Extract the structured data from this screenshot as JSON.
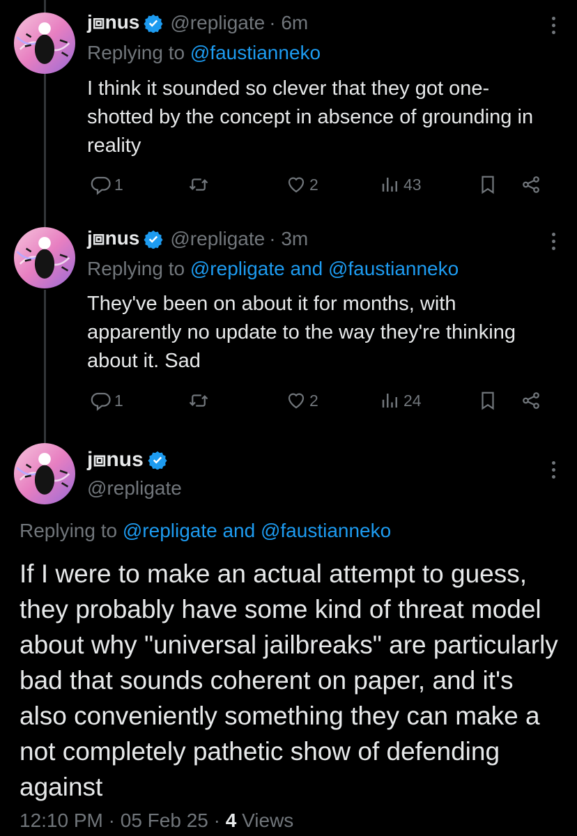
{
  "author": {
    "name": "j⧈nus",
    "handle": "@repligate"
  },
  "replies": [
    {
      "time": "· 6m",
      "replying_prefix": "Replying to",
      "replying_mentions": "@faustianneko",
      "text": "I think it sounded so clever that they got one-shotted by the concept in absence of grounding in reality",
      "stats": {
        "replies": "1",
        "retweets": "",
        "likes": "2",
        "views": "43"
      }
    },
    {
      "time": "· 3m",
      "replying_prefix": "Replying to",
      "replying_mentions": "@repligate and @faustianneko",
      "text": "They've been on about it for months, with apparently no update to the way they're thinking about it. Sad",
      "stats": {
        "replies": "1",
        "retweets": "",
        "likes": "2",
        "views": "24"
      }
    }
  ],
  "main_tweet": {
    "replying_prefix": "Replying to",
    "replying_mentions": "@repligate and @faustianneko",
    "text": "If I were to make an actual attempt to guess, they probably have some kind of threat model about why \"universal jailbreaks\" are particularly bad that sounds coherent on paper, and it's also conveniently something they can make a not completely pathetic show of defending against",
    "time": "12:10 PM",
    "date": "05 Feb 25",
    "views_count": "4",
    "views_label": "Views"
  },
  "colors": {
    "accent": "#1d9bf0",
    "muted": "#71767b",
    "text": "#e7e9ea",
    "background": "#000000"
  },
  "icons": [
    "reply-icon",
    "retweet-icon",
    "like-icon",
    "views-icon",
    "bookmark-icon",
    "share-icon",
    "verified-badge-icon",
    "more-icon"
  ]
}
